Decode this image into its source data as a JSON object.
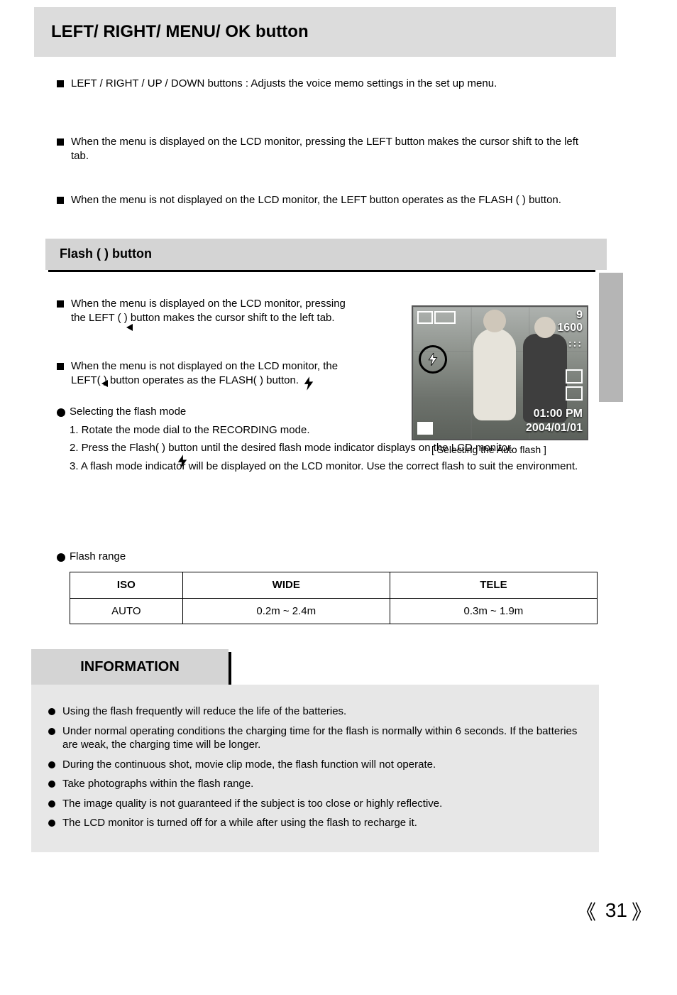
{
  "header": "LEFT/ RIGHT/ MENU/ OK button",
  "b1": "LEFT / RIGHT / UP / DOWN buttons : Adjusts the voice memo settings in the set up menu.",
  "b2": "When the menu is displayed on the LCD monitor, pressing the LEFT button makes the cursor shift to the left tab.",
  "b3": "When the menu is not displayed on the LCD monitor, the LEFT button operates as the FLASH (      ) button.",
  "flash_title": "Flash (      ) button",
  "flash_b1_a": "When the menu is displayed on the LCD monitor, pressing",
  "flash_b1_b": "the LEFT (     ) button makes the cursor shift to the left tab.",
  "flash_b2_a": "When the menu is not displayed on the LCD monitor, the",
  "flash_b2_b": "LEFT(     ) button operates as the FLASH(      ) button.",
  "sel1_lead": "Selecting the flash mode",
  "sel1_1": "1. Rotate the mode dial to the RECORDING mode.",
  "sel1_2": "2. Press the Flash(     ) button until the desired flash mode indicator displays on the LCD monitor.",
  "sel1_3": "3. A flash mode indicator will be displayed on the LCD monitor. Use the correct flash to suit the environment.",
  "range_label": "Flash range",
  "lcd_label": "[ Selecting the Auto flash ]",
  "lcd": {
    "shots": "9",
    "res": "1600",
    "time": "01:00 PM",
    "date": "2004/01/01"
  },
  "chart_data": {
    "type": "table",
    "title": "Flash range",
    "headers": [
      "ISO",
      "WIDE",
      "TELE"
    ],
    "rows": [
      [
        "AUTO",
        "0.2m ~ 2.4m",
        "0.3m ~ 1.9m"
      ]
    ]
  },
  "info_title": "INFORMATION",
  "info": [
    "Using the flash frequently will reduce the life of the batteries.",
    "Under normal operating conditions the charging time for the flash is normally within 6 seconds. If the batteries are weak, the charging time will be longer.",
    "During the continuous shot, movie clip mode, the flash function will not operate.",
    "Take photographs within the flash range.",
    "The image quality is not guaranteed if the subject is too close or highly reflective.",
    "The LCD monitor is turned off for a while after using the flash to recharge it."
  ],
  "page_num": "31"
}
